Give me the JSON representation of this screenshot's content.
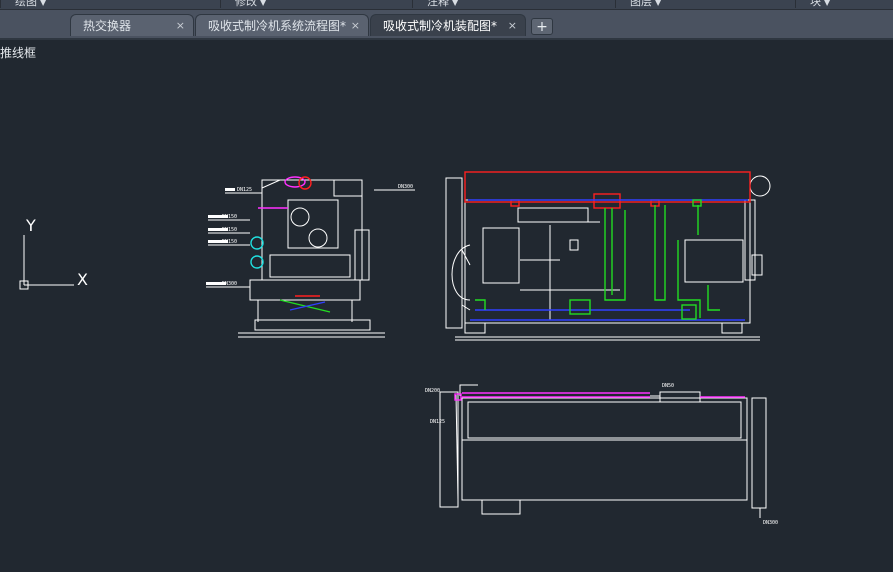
{
  "ribbon": {
    "panels": [
      "绘图",
      "修改",
      "注释",
      "图层",
      "块"
    ]
  },
  "tabs": [
    {
      "label": "热交换器",
      "active": false
    },
    {
      "label": "吸收式制冷机系统流程图*",
      "active": false
    },
    {
      "label": "吸收式制冷机装配图*",
      "active": true
    }
  ],
  "tab_add_label": "+",
  "close_glyph": "×",
  "viewport": {
    "label": "推线框",
    "ucs_y": "Y",
    "ucs_x": "X"
  },
  "drawing": {
    "side_view_labels": [
      "DN125",
      "DN150",
      "DN150",
      "DN150",
      "DN300",
      "DN300"
    ],
    "top_view_labels": [
      "DN200",
      "DN125",
      "DN50",
      "DN300"
    ]
  },
  "colors": {
    "background": "#212830",
    "lines": "#ffffff",
    "red": "#ff2020",
    "green": "#22dd22",
    "magenta": "#ff30ff",
    "blue": "#3040ff",
    "cyan": "#20e0e0"
  }
}
